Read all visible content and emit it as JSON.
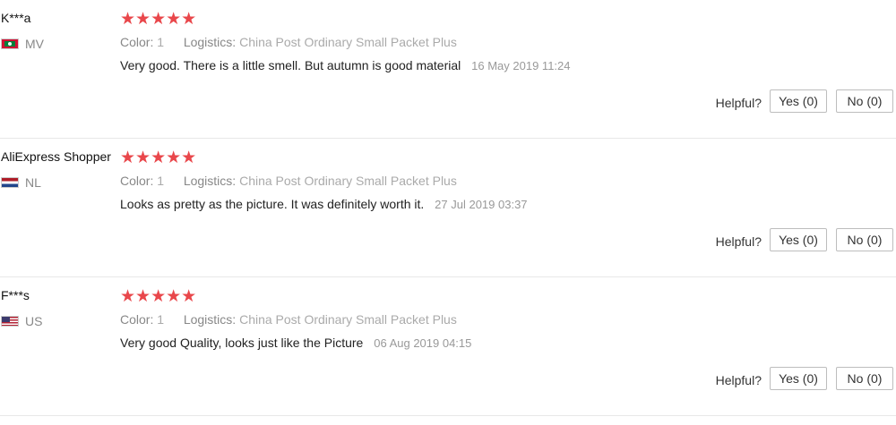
{
  "reviews": [
    {
      "name": "K***a",
      "country": "MV",
      "flag_icon": "maldives-flag-icon",
      "stars": "★★★★★",
      "color_label": "Color:",
      "color_value": "1",
      "logistics_label": "Logistics:",
      "logistics_value": "China Post Ordinary Small Packet Plus",
      "text": "Very good. There is a little smell. But autumn is good material",
      "date": "16 May 2019 11:24",
      "helpful_label": "Helpful?",
      "yes_label": "Yes (0)",
      "no_label": "No (0)"
    },
    {
      "name": "AliExpress Shopper",
      "country": "NL",
      "flag_icon": "netherlands-flag-icon",
      "stars": "★★★★★",
      "color_label": "Color:",
      "color_value": "1",
      "logistics_label": "Logistics:",
      "logistics_value": "China Post Ordinary Small Packet Plus",
      "text": "Looks as pretty as the picture. It was definitely worth it.",
      "date": "27 Jul 2019 03:37",
      "helpful_label": "Helpful?",
      "yes_label": "Yes (0)",
      "no_label": "No (0)"
    },
    {
      "name": "F***s",
      "country": "US",
      "flag_icon": "united-states-flag-icon",
      "stars": "★★★★★",
      "color_label": "Color:",
      "color_value": "1",
      "logistics_label": "Logistics:",
      "logistics_value": "China Post Ordinary Small Packet Plus",
      "text": "Very good Quality, looks just like the Picture",
      "date": "06 Aug 2019 04:15",
      "helpful_label": "Helpful?",
      "yes_label": "Yes (0)",
      "no_label": "No (0)"
    }
  ],
  "colors": {
    "star": "#e9474b",
    "meta_text": "#999999",
    "divider": "#e8e8e8"
  }
}
